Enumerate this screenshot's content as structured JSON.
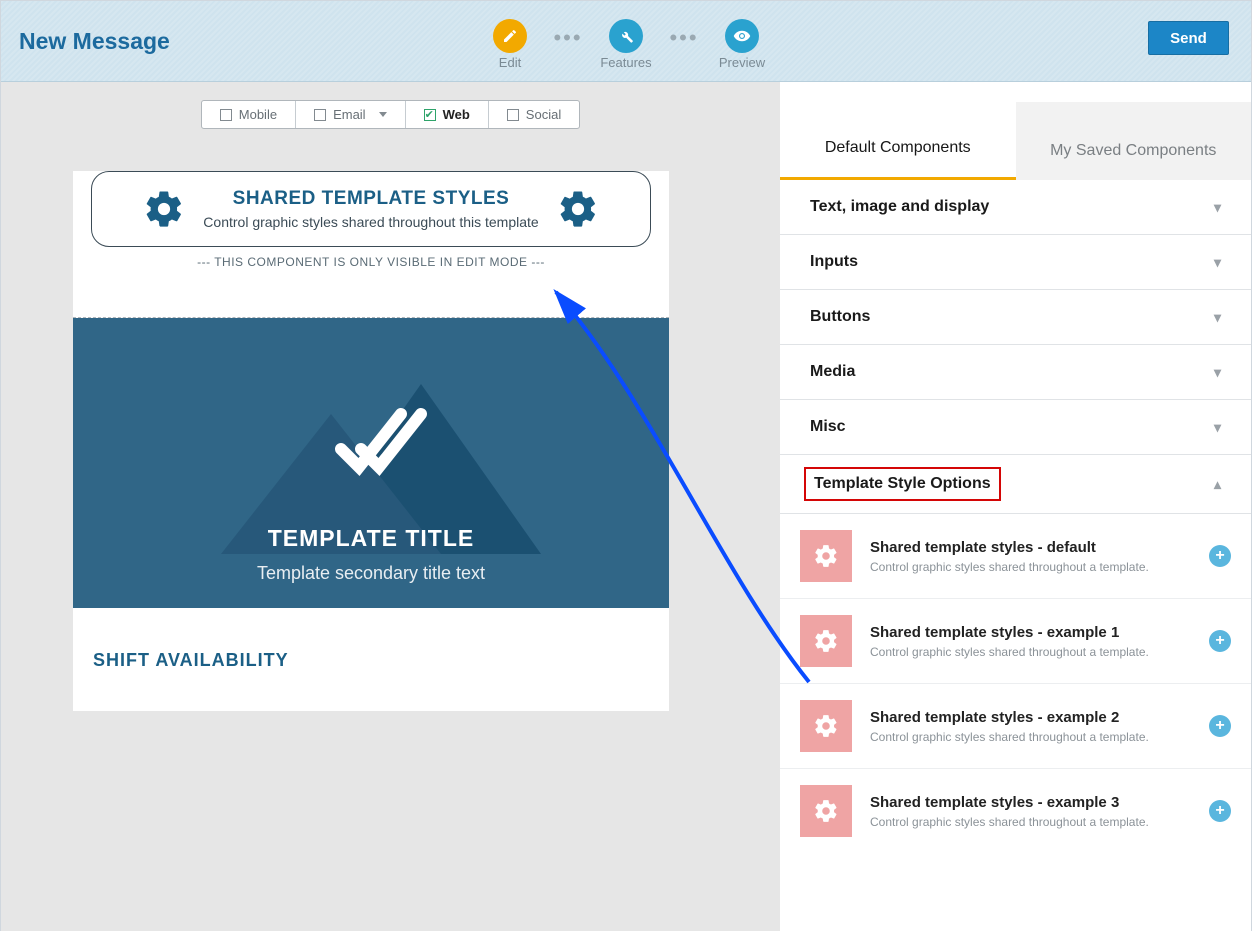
{
  "header": {
    "title": "New Message",
    "items": [
      {
        "label": "Edit",
        "color": "#f2a900",
        "icon": "pencil"
      },
      {
        "label": "Features",
        "color": "#2aa2cf",
        "icon": "wrench"
      },
      {
        "label": "Preview",
        "color": "#2aa2cf",
        "icon": "eye"
      }
    ],
    "send": "Send"
  },
  "channels": {
    "mobile": "Mobile",
    "email": "Email",
    "web": "Web",
    "social": "Social"
  },
  "stylesBox": {
    "title": "SHARED TEMPLATE STYLES",
    "subtitle": "Control graphic styles shared throughout this template",
    "note": "--- THIS COMPONENT IS ONLY VISIBLE IN EDIT MODE ---"
  },
  "hero": {
    "title": "TEMPLATE TITLE",
    "subtitle": "Template secondary title text"
  },
  "section": {
    "title": "SHIFT AVAILABILITY"
  },
  "tabs": {
    "default": "Default Components",
    "saved": "My Saved Components"
  },
  "accordion": [
    {
      "label": "Text, image and display",
      "open": false
    },
    {
      "label": "Inputs",
      "open": false
    },
    {
      "label": "Buttons",
      "open": false
    },
    {
      "label": "Media",
      "open": false
    },
    {
      "label": "Misc",
      "open": false
    },
    {
      "label": "Template Style Options",
      "open": true,
      "highlight": true
    }
  ],
  "templateStyleItems": [
    {
      "title": "Shared template styles - default",
      "desc": "Control graphic styles shared throughout a template."
    },
    {
      "title": "Shared template styles - example 1",
      "desc": "Control graphic styles shared throughout a template."
    },
    {
      "title": "Shared template styles - example 2",
      "desc": "Control graphic styles shared throughout a template."
    },
    {
      "title": "Shared template styles - example 3",
      "desc": "Control graphic styles shared throughout a template."
    }
  ]
}
